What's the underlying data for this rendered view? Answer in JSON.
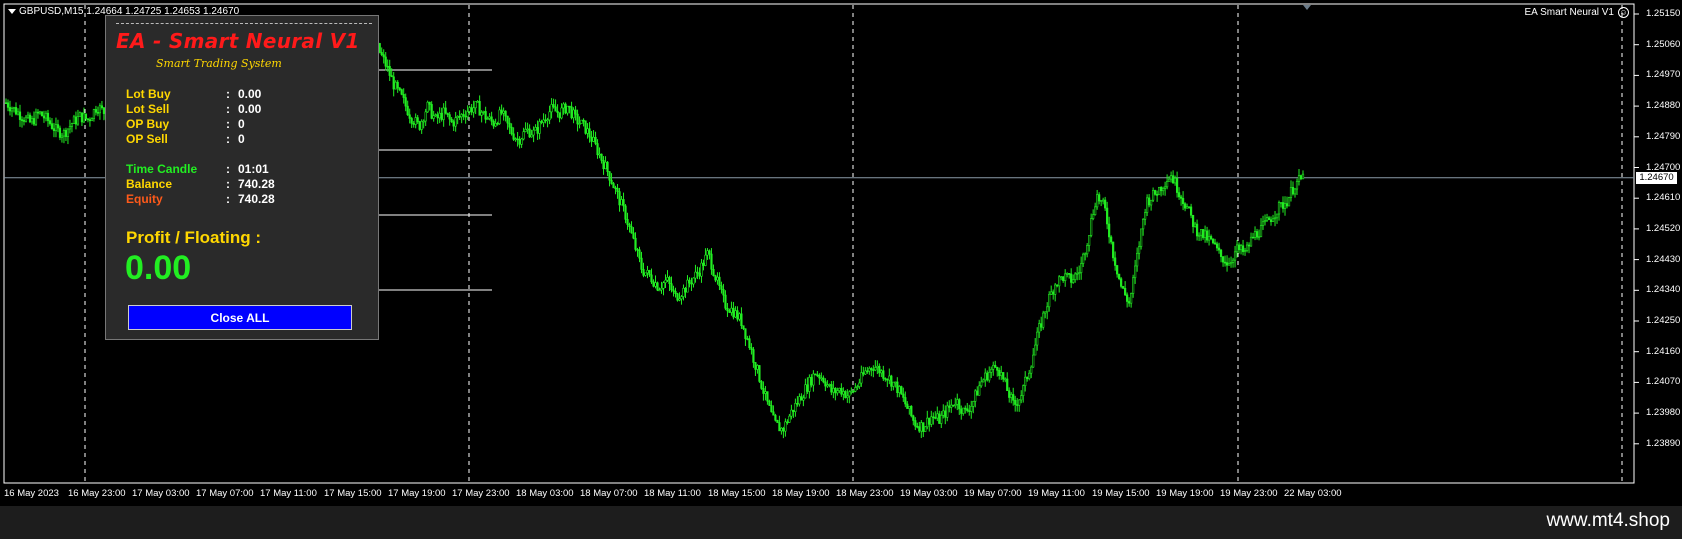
{
  "header": {
    "symbol_quote": "GBPUSD,M15  1.24664 1.24725 1.24653 1.24670",
    "ea_name": "EA Smart Neural V1"
  },
  "price_axis": {
    "labels": [
      "1.25150",
      "1.25060",
      "1.24970",
      "1.24880",
      "1.24790",
      "1.24700",
      "1.24610",
      "1.24520",
      "1.24430",
      "1.24340",
      "1.24250",
      "1.24160",
      "1.24070",
      "1.23980",
      "1.23890"
    ],
    "current": "1.24670",
    "min": 1.2389,
    "max": 1.2515
  },
  "time_axis": {
    "labels": [
      "16 May 2023",
      "16 May 23:00",
      "17 May 03:00",
      "17 May 07:00",
      "17 May 11:00",
      "17 May 15:00",
      "17 May 19:00",
      "17 May 23:00",
      "18 May 03:00",
      "18 May 07:00",
      "18 May 11:00",
      "18 May 15:00",
      "18 May 19:00",
      "18 May 23:00",
      "19 May 03:00",
      "19 May 07:00",
      "19 May 11:00",
      "19 May 15:00",
      "19 May 19:00",
      "19 May 23:00",
      "22 May 03:00"
    ]
  },
  "series": {
    "close_path": [
      1.2489,
      1.2487,
      1.2485,
      1.2483,
      1.2486,
      1.2484,
      1.2481,
      1.248,
      1.2483,
      1.2485,
      1.2484,
      1.2488,
      1.2486,
      1.2482,
      1.2479,
      1.2481,
      1.2478,
      1.248,
      1.2479,
      1.2482,
      1.2484,
      1.2483,
      1.2486,
      1.2487,
      1.2482,
      1.248,
      1.2478,
      1.2476,
      1.2479,
      1.247,
      1.2465,
      1.246,
      1.2455,
      1.245,
      1.244,
      1.243,
      1.2425,
      1.2428,
      1.2435,
      1.244,
      1.245,
      1.246,
      1.247,
      1.248,
      1.2495,
      1.2505,
      1.25,
      1.2494,
      1.249,
      1.2485,
      1.2482,
      1.2488,
      1.2484,
      1.2486,
      1.2483,
      1.2485,
      1.2487,
      1.2488,
      1.2485,
      1.2483,
      1.2486,
      1.2481,
      1.2478,
      1.2481,
      1.248,
      1.2484,
      1.2487,
      1.2486,
      1.2488,
      1.2484,
      1.2482,
      1.2478,
      1.2473,
      1.2468,
      1.2462,
      1.2456,
      1.2448,
      1.244,
      1.2438,
      1.2435,
      1.2437,
      1.2432,
      1.2434,
      1.2437,
      1.244,
      1.2445,
      1.2437,
      1.243,
      1.2428,
      1.2425,
      1.2418,
      1.241,
      1.2402,
      1.2395,
      1.2393,
      1.2398,
      1.2402,
      1.2406,
      1.241,
      1.2408,
      1.2404,
      1.2405,
      1.2403,
      1.2406,
      1.241,
      1.2412,
      1.241,
      1.2408,
      1.2405,
      1.24,
      1.2395,
      1.2394,
      1.2397,
      1.2396,
      1.2399,
      1.2402,
      1.2398,
      1.2401,
      1.2407,
      1.241,
      1.2412,
      1.2406,
      1.24,
      1.2404,
      1.2412,
      1.2422,
      1.243,
      1.2436,
      1.2438,
      1.2437,
      1.244,
      1.245,
      1.2462,
      1.2458,
      1.2445,
      1.2435,
      1.243,
      1.2445,
      1.246,
      1.2462,
      1.2465,
      1.2468,
      1.2463,
      1.2458,
      1.2452,
      1.245,
      1.2448,
      1.2444,
      1.2442,
      1.2446,
      1.2445,
      1.245,
      1.2452,
      1.2455,
      1.2458,
      1.246,
      1.2465,
      1.2467
    ]
  },
  "panel": {
    "title": "EA - Smart Neural V1",
    "subtitle": "Smart Trading System",
    "rows1": [
      {
        "k": "Lot Buy",
        "v": "0.00"
      },
      {
        "k": "Lot Sell",
        "v": "0.00"
      },
      {
        "k": "OP Buy",
        "v": "0"
      },
      {
        "k": "OP Sell",
        "v": "0"
      }
    ],
    "rows2": [
      {
        "k": "Time Candle",
        "v": "01:01"
      },
      {
        "k": "Balance",
        "v": "740.28"
      },
      {
        "k": "Equity",
        "v": "740.28"
      }
    ],
    "colon": ":",
    "profit_label": "Profit / Floating  :",
    "profit_value": "0.00",
    "close_label": "Close ALL"
  },
  "footer": {
    "watermark": "www.mt4.shop"
  },
  "colors": {
    "candle": "#22ee22",
    "panel_title": "#ff1a1a",
    "button": "#0000ff"
  }
}
